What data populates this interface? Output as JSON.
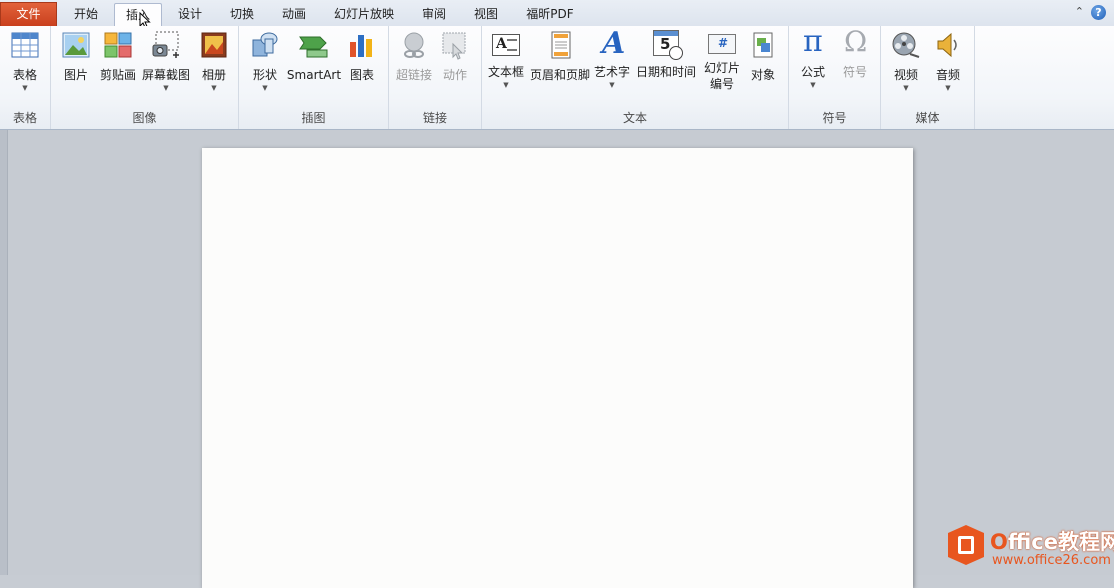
{
  "tabs": [
    {
      "label": "文件",
      "key": "file"
    },
    {
      "label": "开始",
      "key": "home"
    },
    {
      "label": "插入",
      "key": "insert",
      "active": true
    },
    {
      "label": "设计",
      "key": "design"
    },
    {
      "label": "切换",
      "key": "transitions"
    },
    {
      "label": "动画",
      "key": "animations"
    },
    {
      "label": "幻灯片放映",
      "key": "slideshow"
    },
    {
      "label": "审阅",
      "key": "review"
    },
    {
      "label": "视图",
      "key": "view"
    },
    {
      "label": "福昕PDF",
      "key": "foxitpdf"
    }
  ],
  "window": {
    "minimize_ribbon_glyph": "⌃",
    "help_glyph": "?"
  },
  "groups": {
    "tables": {
      "label": "表格",
      "buttons": {
        "table": "表格"
      }
    },
    "images": {
      "label": "图像",
      "buttons": {
        "picture": "图片",
        "clipart": "剪贴画",
        "screenshot": "屏幕截图",
        "album": "相册"
      }
    },
    "illustrations": {
      "label": "插图",
      "buttons": {
        "shapes": "形状",
        "smartart": "SmartArt",
        "chart": "图表"
      }
    },
    "links": {
      "label": "链接",
      "buttons": {
        "hyperlink": "超链接",
        "action": "动作"
      }
    },
    "text": {
      "label": "文本",
      "buttons": {
        "textbox": "文本框",
        "headerfooter": "页眉和页脚",
        "wordart": "艺术字",
        "datetime": "日期和时间",
        "slidenumber_line1": "幻灯片",
        "slidenumber_line2": "编号",
        "object": "对象"
      }
    },
    "symbols": {
      "label": "符号",
      "buttons": {
        "equation": "公式",
        "symbol": "符号"
      }
    },
    "media": {
      "label": "媒体",
      "buttons": {
        "video": "视频",
        "audio": "音频"
      }
    }
  },
  "icons": {
    "equation_glyph": "π",
    "symbol_glyph": "Ω",
    "wordart_glyph": "A",
    "textbox_glyph": "A",
    "datetime_glyph": "5",
    "slidenumber_glyph": "#"
  },
  "watermark": {
    "brand": "Office教程网",
    "brand_o": "O",
    "brand_rest": "ffice教程网",
    "url": "www.office26.com"
  },
  "colors": {
    "file_tab": "#d24b24",
    "accent_blue": "#1f5fb8",
    "ribbon_bg": "#f2f5f9",
    "workspace": "#c6cbd2",
    "watermark": "#e8561f"
  }
}
